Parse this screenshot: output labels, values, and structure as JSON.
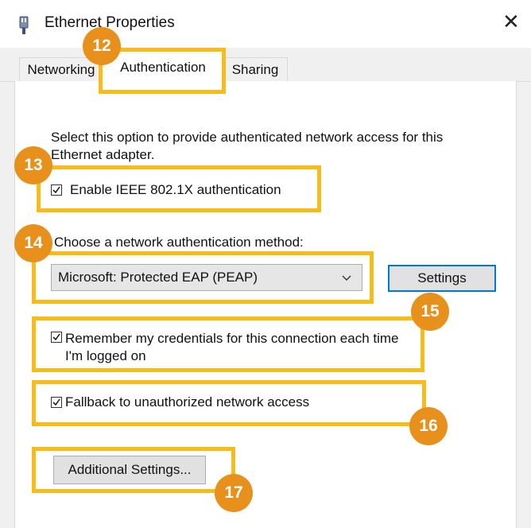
{
  "window": {
    "title": "Ethernet Properties",
    "close_icon": "close-icon",
    "app_icon": "network-adapter-icon"
  },
  "tabs": [
    {
      "label": "Networking",
      "active": false
    },
    {
      "label": "Authentication",
      "active": true
    },
    {
      "label": "Sharing",
      "active": false
    }
  ],
  "panel": {
    "description": "Select this option to provide authenticated network access for this Ethernet adapter.",
    "enable_8021x": {
      "label": "Enable IEEE 802.1X authentication",
      "checked": true
    },
    "method_label": "Choose a network authentication method:",
    "method_select": {
      "value": "Microsoft: Protected EAP (PEAP)"
    },
    "settings_button": "Settings",
    "remember_credentials": {
      "label": "Remember my credentials for this connection each time I'm logged on",
      "checked": true
    },
    "fallback": {
      "label": "Fallback to unauthorized network access",
      "checked": true
    },
    "additional_settings_button": "Additional Settings..."
  },
  "annotations": {
    "color_box": "#f7bc19",
    "color_badge": "#e8901c",
    "badges": [
      "12",
      "13",
      "14",
      "15",
      "16",
      "17"
    ]
  }
}
